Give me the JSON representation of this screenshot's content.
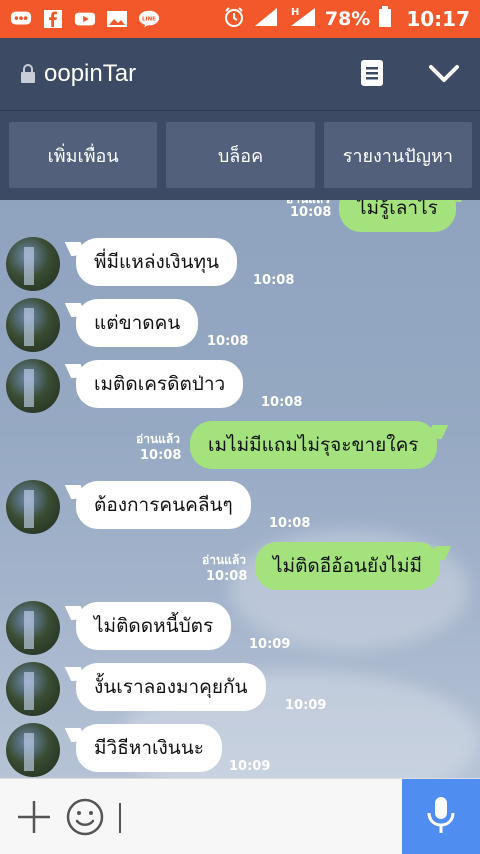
{
  "status_bar": {
    "battery": "78%",
    "time": "10:17",
    "network": "H"
  },
  "header": {
    "title": "oopinTar"
  },
  "actions": {
    "add_friend": "เพิ่มเพื่อน",
    "block": "บล็อค",
    "report": "รายงานปัญหา"
  },
  "messages": [
    {
      "side": "out",
      "text": "ไม่รู้เลาไร",
      "time": "10:08",
      "read": "อ่านแล้ว"
    },
    {
      "side": "in",
      "text": "พี่มีแหล่งเงินทุน",
      "time": "10:08"
    },
    {
      "side": "in",
      "text": "แต่ขาดคน",
      "time": "10:08"
    },
    {
      "side": "in",
      "text": "เมติดเครดิตป่าว",
      "time": "10:08"
    },
    {
      "side": "out",
      "text": "เมไม่มีแถมไม่รุจะขายใคร",
      "time": "10:08",
      "read": "อ่านแล้ว"
    },
    {
      "side": "in",
      "text": "ต้องการคนคลีนๆ",
      "time": "10:08"
    },
    {
      "side": "out",
      "text": "ไม่ติดอีอ้อนยังไม่มี",
      "time": "10:08",
      "read": "อ่านแล้ว"
    },
    {
      "side": "in",
      "text": "ไม่ติดดหนี้บัตร",
      "time": "10:09"
    },
    {
      "side": "in",
      "text": "งั้นเราลองมาคุยกัน",
      "time": "10:09"
    },
    {
      "side": "in",
      "text": "มีวิธีหาเงินนะ",
      "time": "10:09"
    }
  ],
  "colors": {
    "status_bar": "#f2582a",
    "header": "#3d4a63",
    "outgoing_bubble": "#a4e27d",
    "mic_button": "#4f8ef0"
  }
}
